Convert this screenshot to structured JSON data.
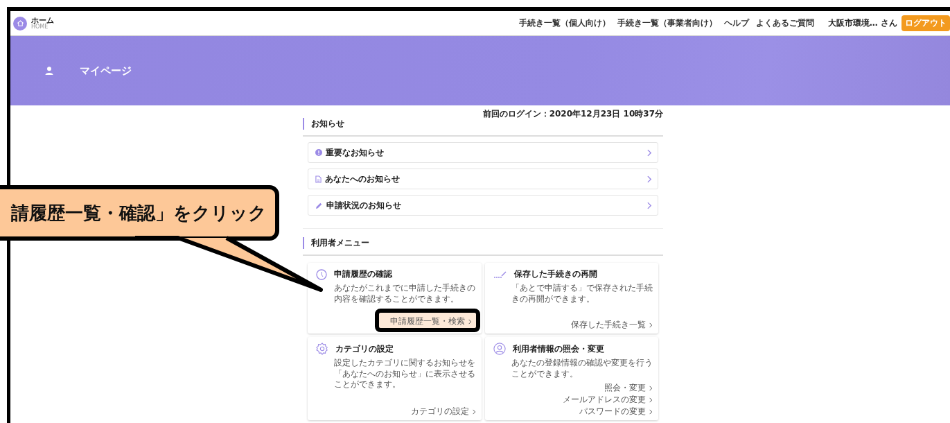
{
  "header": {
    "home_label": "ホーム",
    "home_sublabel": "HOME",
    "nav": [
      "手続き一覧（個人向け）",
      "手続き一覧（事業者向け）",
      "ヘルプ",
      "よくあるご質問"
    ],
    "user": "大阪市環境… さん",
    "logout": "ログアウト"
  },
  "banner": {
    "title": "マイページ"
  },
  "notices": {
    "title": "お知らせ",
    "last_login": "前回のログイン：2020年12月23日 10時37分",
    "items": [
      {
        "kind": "important",
        "label": "重要なお知らせ"
      },
      {
        "kind": "document",
        "label": "あなたへのお知らせ"
      },
      {
        "kind": "pencil",
        "label": "申請状況のお知らせ"
      }
    ]
  },
  "menu": {
    "title": "利用者メニュー",
    "cards": [
      {
        "kind": "history",
        "title": "申請履歴の確認",
        "description": "あなたがこれまでに申請した手続きの内容を確認することができます。",
        "links": [
          {
            "label": "申請履歴一覧・検索",
            "highlighted": true
          }
        ]
      },
      {
        "kind": "saved",
        "title": "保存した手続きの再開",
        "description": "「あとで申請する」で保存された手続きの再開ができます。",
        "links": [
          {
            "label": "保存した手続き一覧",
            "highlighted": false
          }
        ]
      },
      {
        "kind": "category",
        "title": "カテゴリの設定",
        "description": "設定したカテゴリに関するお知らせを「あなたへのお知らせ」に表示させることができます。",
        "links": [
          {
            "label": "カテゴリの設定",
            "highlighted": false
          }
        ]
      },
      {
        "kind": "user",
        "title": "利用者情報の照会・変更",
        "description": "あなたの登録情報の確認や変更を行うことができます。",
        "links": [
          {
            "label": "照会・変更",
            "highlighted": false
          },
          {
            "label": "メールアドレスの変更",
            "highlighted": false
          },
          {
            "label": "パスワードの変更",
            "highlighted": false
          }
        ]
      }
    ]
  },
  "callout": {
    "text": "請履歴一覧・確認」をクリック"
  }
}
